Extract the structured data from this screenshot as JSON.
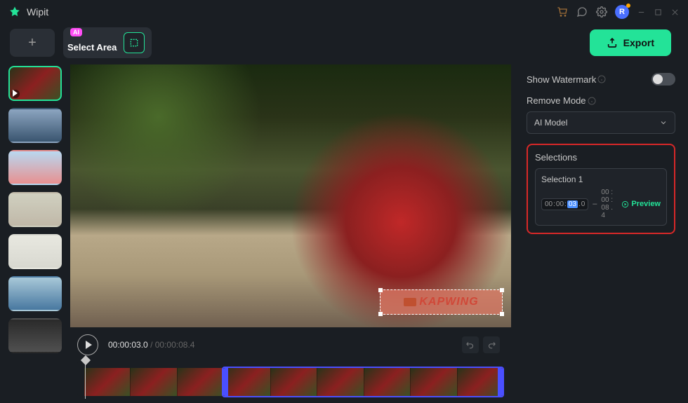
{
  "app": {
    "title": "Wipit",
    "avatar_letter": "R"
  },
  "toolbar": {
    "ai_badge": "AI",
    "select_area": "Select Area",
    "export": "Export"
  },
  "player": {
    "current_time": "00:00:03.0",
    "total_time": "00:00:08.4"
  },
  "panel": {
    "show_watermark": "Show Watermark",
    "remove_mode": "Remove Mode",
    "mode_value": "AI Model",
    "selections_title": "Selections",
    "selection_name": "Selection 1",
    "sel_time_start_h": "00",
    "sel_time_start_m": "00",
    "sel_time_start_s": "03",
    "sel_time_start_f": "0",
    "sel_time_end": "00 : 00 : 08 . 4",
    "preview_label": "Preview"
  },
  "watermark_text": "KAPWING"
}
